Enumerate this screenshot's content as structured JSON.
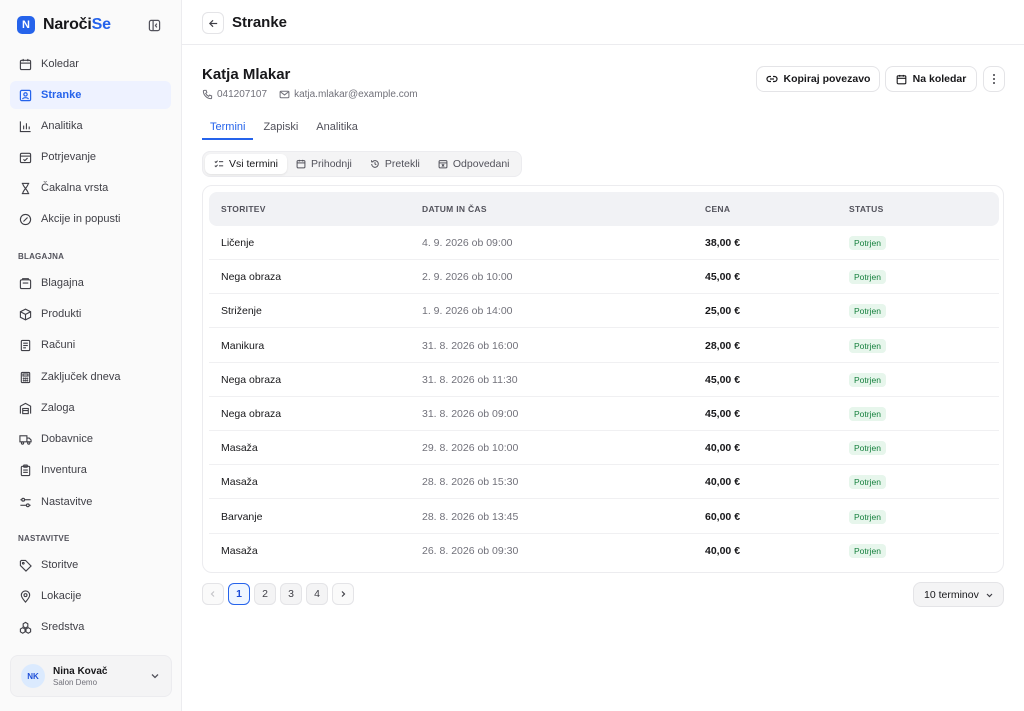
{
  "brand": {
    "name_main": "Naroči",
    "name_accent": "Se",
    "logo_letter": "N",
    "accent_color": "#2563eb"
  },
  "sidebar": {
    "items": [
      {
        "label": "Koledar",
        "icon": "calendar-icon"
      },
      {
        "label": "Stranke",
        "icon": "contacts-icon",
        "active": true
      },
      {
        "label": "Analitika",
        "icon": "bar-chart-icon"
      },
      {
        "label": "Potrjevanje",
        "icon": "calendar-check-icon"
      },
      {
        "label": "Čakalna vrsta",
        "icon": "hourglass-icon"
      },
      {
        "label": "Akcije in popusti",
        "icon": "discount-icon"
      }
    ],
    "section_blagajna": "BLAGAJNA",
    "blagajna_items": [
      {
        "label": "Blagajna",
        "icon": "register-icon"
      },
      {
        "label": "Produkti",
        "icon": "package-icon"
      },
      {
        "label": "Računi",
        "icon": "receipt-icon"
      },
      {
        "label": "Zaključek dneva",
        "icon": "calculator-icon"
      },
      {
        "label": "Zaloga",
        "icon": "warehouse-icon"
      },
      {
        "label": "Dobavnice",
        "icon": "truck-icon"
      },
      {
        "label": "Inventura",
        "icon": "clipboard-icon"
      },
      {
        "label": "Nastavitve",
        "icon": "sliders-icon"
      }
    ],
    "section_nastavitve": "NASTAVITVE",
    "nastavitve_items": [
      {
        "label": "Storitve",
        "icon": "tag-icon"
      },
      {
        "label": "Lokacije",
        "icon": "map-pin-icon"
      },
      {
        "label": "Sredstva",
        "icon": "resources-icon"
      }
    ]
  },
  "user": {
    "initials": "NK",
    "name": "Nina Kovač",
    "org": "Salon Demo"
  },
  "header": {
    "title": "Stranke"
  },
  "client": {
    "name": "Katja Mlakar",
    "phone": "041207107",
    "email": "katja.mlakar@example.com"
  },
  "actions": {
    "copy_link": "Kopiraj povezavo",
    "to_calendar": "Na koledar"
  },
  "tabs": [
    {
      "label": "Termini",
      "active": true
    },
    {
      "label": "Zapiski"
    },
    {
      "label": "Analitika"
    }
  ],
  "filters": [
    {
      "label": "Vsi termini",
      "active": true
    },
    {
      "label": "Prihodnji"
    },
    {
      "label": "Pretekli"
    },
    {
      "label": "Odpovedani"
    }
  ],
  "table": {
    "columns": [
      "STORITEV",
      "DATUM IN ČAS",
      "CENA",
      "STATUS"
    ],
    "rows": [
      {
        "service": "Ličenje",
        "datetime": "4. 9. 2026 ob 09:00",
        "price": "38,00 €",
        "status": "Potrjen"
      },
      {
        "service": "Nega obraza",
        "datetime": "2. 9. 2026 ob 10:00",
        "price": "45,00 €",
        "status": "Potrjen"
      },
      {
        "service": "Striženje",
        "datetime": "1. 9. 2026 ob 14:00",
        "price": "25,00 €",
        "status": "Potrjen"
      },
      {
        "service": "Manikura",
        "datetime": "31. 8. 2026 ob 16:00",
        "price": "28,00 €",
        "status": "Potrjen"
      },
      {
        "service": "Nega obraza",
        "datetime": "31. 8. 2026 ob 11:30",
        "price": "45,00 €",
        "status": "Potrjen"
      },
      {
        "service": "Nega obraza",
        "datetime": "31. 8. 2026 ob 09:00",
        "price": "45,00 €",
        "status": "Potrjen"
      },
      {
        "service": "Masaža",
        "datetime": "29. 8. 2026 ob 10:00",
        "price": "40,00 €",
        "status": "Potrjen"
      },
      {
        "service": "Masaža",
        "datetime": "28. 8. 2026 ob 15:30",
        "price": "40,00 €",
        "status": "Potrjen"
      },
      {
        "service": "Barvanje",
        "datetime": "28. 8. 2026 ob 13:45",
        "price": "60,00 €",
        "status": "Potrjen"
      },
      {
        "service": "Masaža",
        "datetime": "26. 8. 2026 ob 09:30",
        "price": "40,00 €",
        "status": "Potrjen"
      }
    ]
  },
  "pagination": {
    "pages": [
      "1",
      "2",
      "3",
      "4"
    ],
    "current": "1",
    "per_page": "10 terminov"
  }
}
